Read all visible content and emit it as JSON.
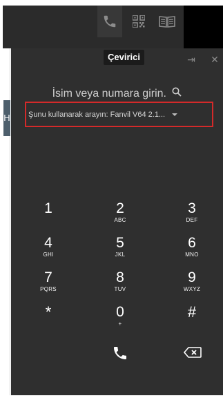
{
  "header": {
    "tabs": [
      {
        "icon": "phone-icon",
        "active": true
      },
      {
        "icon": "qr-code-icon",
        "active": false
      },
      {
        "icon": "book-icon",
        "active": false
      }
    ],
    "tooltip": "Çevirici"
  },
  "left_tab_letter": "H",
  "panel": {
    "tools": [
      {
        "icon": "pin-icon",
        "glyph": "⇥"
      },
      {
        "icon": "close-icon",
        "glyph": "✕"
      }
    ],
    "search_prompt": "İsim veya numara girin.",
    "via_label": "Şunu kullanarak arayın: Fanvil V64 2.1...",
    "highlight_color": "#d42a2a"
  },
  "keypad": {
    "keys": [
      {
        "digit": "1",
        "letters": ""
      },
      {
        "digit": "2",
        "letters": "ABC"
      },
      {
        "digit": "3",
        "letters": "DEF"
      },
      {
        "digit": "4",
        "letters": "GHI"
      },
      {
        "digit": "5",
        "letters": "JKL"
      },
      {
        "digit": "6",
        "letters": "MNO"
      },
      {
        "digit": "7",
        "letters": "PQRS"
      },
      {
        "digit": "8",
        "letters": "TUV"
      },
      {
        "digit": "9",
        "letters": "WXYZ"
      },
      {
        "digit": "*",
        "letters": ""
      },
      {
        "digit": "0",
        "letters": "+"
      },
      {
        "digit": "#",
        "letters": ""
      }
    ],
    "call_icon": "phone-call-icon",
    "backspace_icon": "backspace-icon"
  }
}
